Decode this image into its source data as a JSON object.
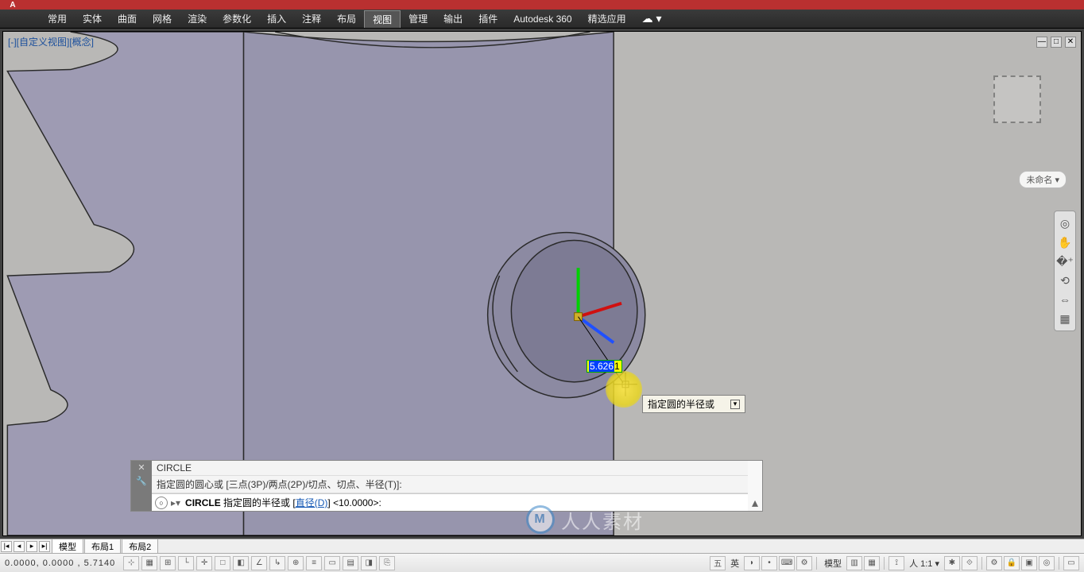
{
  "ribbon": {
    "tabs": [
      "常用",
      "实体",
      "曲面",
      "网格",
      "渲染",
      "参数化",
      "插入",
      "注释",
      "布局",
      "视图",
      "管理",
      "输出",
      "插件",
      "Autodesk 360",
      "精选应用"
    ],
    "active_index": 9
  },
  "viewport": {
    "label": "[-][自定义视图][概念]",
    "unnamed_pill": "未命名 ▾"
  },
  "dynamic_input": {
    "selected": "5.626",
    "rest": "1"
  },
  "tooltip": {
    "text": "指定圆的半径或"
  },
  "command": {
    "hist_line1": "CIRCLE",
    "hist_line2": "指定圆的圆心或 [三点(3P)/两点(2P)/切点、切点、半径(T)]:",
    "prompt_cmd": "CIRCLE",
    "prompt_text_a": " 指定圆的半径或 [",
    "prompt_link": "直径(D)",
    "prompt_text_b": "] <10.0000>:"
  },
  "layout_tabs": {
    "items": [
      "模型",
      "布局1",
      "布局2"
    ],
    "active_index": 0
  },
  "status": {
    "coords": "0.0000,  0.0000 ,  5.7140",
    "ime": "英",
    "model_label": "模型",
    "scale": "1:1"
  },
  "watermark": {
    "logo": "M",
    "text": "人人素材"
  }
}
